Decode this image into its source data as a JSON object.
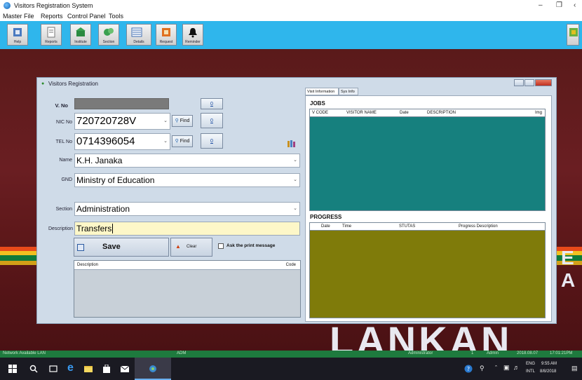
{
  "window": {
    "title": "Visitors Registration System"
  },
  "menu": [
    "Master File",
    "Reports",
    "Control Panel",
    "Tools"
  ],
  "toolbar": [
    {
      "label": "Help",
      "icon": "help-icon"
    },
    {
      "label": "Reports",
      "icon": "reports-icon"
    },
    {
      "label": "Institute",
      "icon": "institute-icon"
    },
    {
      "label": "Section",
      "icon": "section-icon"
    },
    {
      "label": "Details",
      "icon": "details-icon"
    },
    {
      "label": "Request",
      "icon": "request-icon"
    },
    {
      "label": "Reminder",
      "icon": "reminder-icon"
    }
  ],
  "dialog": {
    "title": "Visitors Registration",
    "labels": {
      "vno": "V. No",
      "nic": "NIC No",
      "tel": "TEL No",
      "name": "Name",
      "gnd": "GND",
      "section": "Section",
      "description": "Description"
    },
    "values": {
      "vno": "",
      "nic": "720720728V",
      "tel": "0714396054",
      "name": "K.H. Janaka",
      "gnd": "Ministry of Education",
      "section": "Administration",
      "description": "Transfers"
    },
    "counts": {
      "vno": "0",
      "nic": "0",
      "tel": "0"
    },
    "find_label": "Find",
    "save_label": "Save",
    "clear_label": "Clear",
    "print_label": "Ask the print message",
    "list_headers": {
      "description": "Description",
      "code": "Code"
    }
  },
  "right": {
    "tabs": [
      "Visit Information",
      "Sys Info"
    ],
    "jobs_title": "JOBS",
    "jobs_headers": [
      "V CODE",
      "VISITOR NAME",
      "Date",
      "DESCRIPTION",
      "Img"
    ],
    "progress_title": "PROGRESS",
    "progress_headers": [
      "Date",
      "Time",
      "STUTAS",
      "Progress Description"
    ]
  },
  "background": {
    "text_line1": "E A",
    "text_line2": "SRI LANKAN"
  },
  "statusbar": {
    "network": "Network Available LAN",
    "user_code": "ADM",
    "role": "Administrator",
    "num": "1",
    "user": "Admin",
    "date": "2018.08.07",
    "time": "17:01:21PM"
  },
  "taskbar": {
    "lang1": "ENG",
    "lang2": "INTL",
    "time": "9:55 AM",
    "date": "8/8/2018"
  },
  "colors": {
    "toolbar": "#2fb6ec",
    "jobs_grid": "#16807e",
    "progress_grid": "#7f7b0a",
    "status": "#1e7a3e"
  }
}
